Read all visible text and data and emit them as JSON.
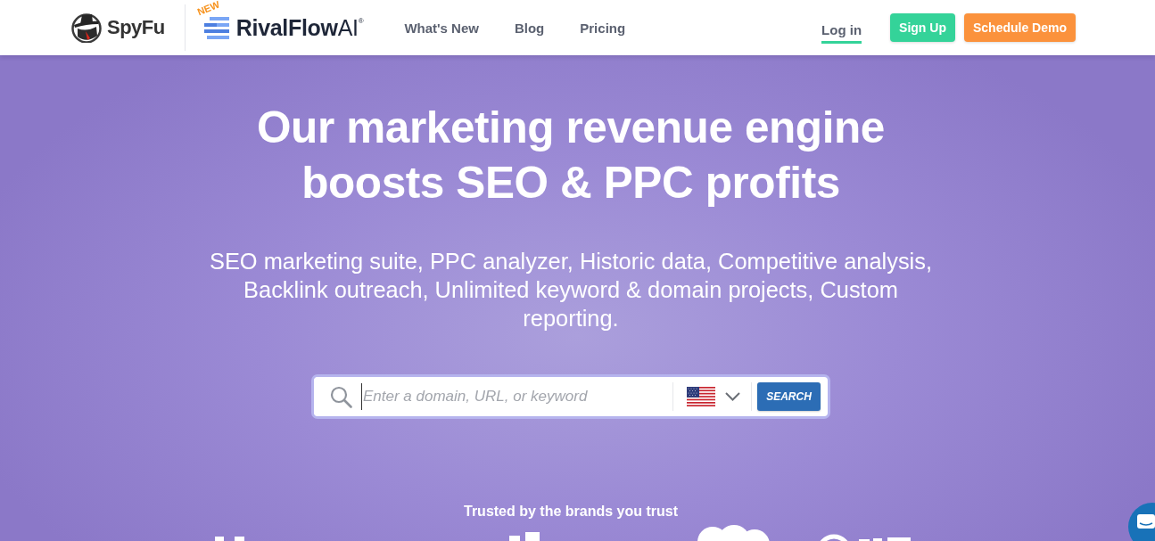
{
  "header": {
    "logo": {
      "text": "SpyFu"
    },
    "partner_logo": {
      "badge": "NEW",
      "text": "**RivalFlow**AI$^{®}$"
    },
    "nav": [
      {
        "label": "What's New"
      },
      {
        "label": "Blog"
      },
      {
        "label": "Pricing"
      }
    ],
    "login": {
      "label": "Log in"
    },
    "buttons": [
      {
        "label": "Sign Up",
        "kind": "primary"
      },
      {
        "label": "Schedule Demo",
        "kind": "accent"
      }
    ]
  },
  "hero": {
    "headline": "Our marketing revenue engine boosts SEO & PPC profits",
    "subtitle": "SEO marketing suite, PPC analyzer, Historic data, Competitive analysis, Backlink outreach, Unlimited keyword & domain projects, Custom reporting.",
    "search": {
      "placeholder": "Enter a domain, URL, or keyword",
      "button": "SEARCH"
    },
    "trusted_label": "Trusted by the brands you trust"
  }
}
